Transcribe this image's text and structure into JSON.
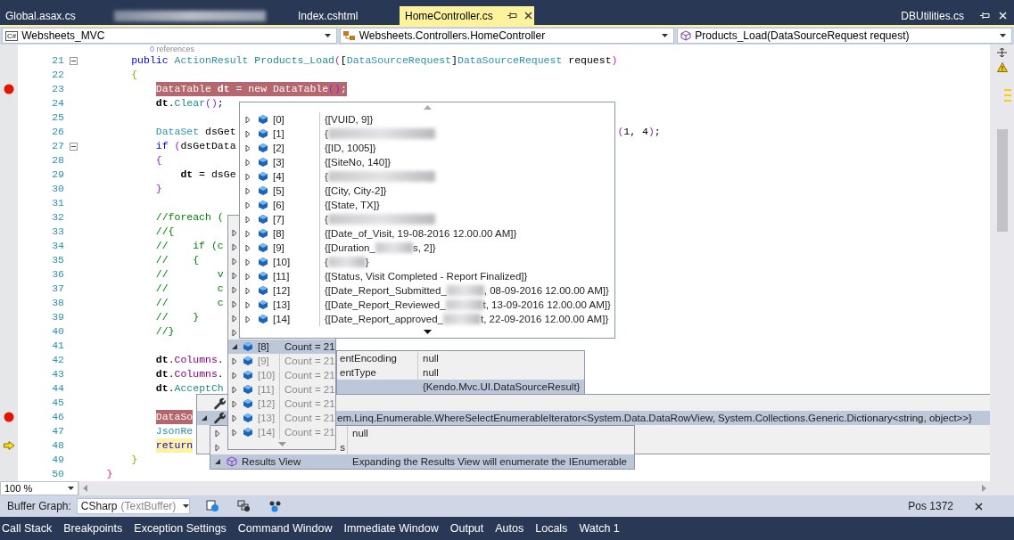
{
  "document_tabs": [
    {
      "label": "Global.asax.cs",
      "selected": false
    },
    {
      "label": "Index.cshtml",
      "selected": false
    },
    {
      "label": "HomeController.cs",
      "selected": true
    }
  ],
  "preview_tab": {
    "label": "DBUtilities.cs"
  },
  "navigation_bar": {
    "project_badge": "C#",
    "project": "Websheets_MVC",
    "type": "Websheets.Controllers.HomeController",
    "member": "Products_Load(DataSourceRequest request)"
  },
  "editor": {
    "codelens": "0 references",
    "zoom": "100 %",
    "lines": [
      {
        "number": "21",
        "breakpoint": false,
        "current_statement": false,
        "fold": true,
        "kind": "class",
        "tokens": [
          {
            "kind": "kw",
            "text": "public "
          },
          {
            "kind": "type",
            "text": "ActionResult "
          },
          {
            "kind": "method",
            "text": "Products_Load"
          },
          {
            "kind": "brace3",
            "text": "("
          },
          {
            "kind": "plain",
            "text": "["
          },
          {
            "kind": "type",
            "text": "DataSourceRequest"
          },
          {
            "kind": "plain",
            "text": "]"
          },
          {
            "kind": "type",
            "text": "DataSourceRequest"
          },
          {
            "kind": "plain",
            "text": " request"
          },
          {
            "kind": "brace3",
            "text": ")"
          }
        ]
      },
      {
        "number": "22",
        "breakpoint": false,
        "current_statement": false,
        "fold": false,
        "kind": "class",
        "tokens": [
          {
            "kind": "brace1",
            "text": "{"
          }
        ]
      },
      {
        "number": "23",
        "breakpoint": true,
        "current_statement": false,
        "fold": false,
        "kind": "method",
        "tokens": [
          {
            "kind": "type",
            "text": "DataTable "
          },
          {
            "kind": "local",
            "text": "dt"
          },
          {
            "kind": "plain",
            "text": " = "
          },
          {
            "kind": "kw",
            "text": "new "
          },
          {
            "kind": "type",
            "text": "DataTable"
          },
          {
            "kind": "brace2",
            "text": "()"
          },
          {
            "kind": "plain",
            "text": ";"
          }
        ]
      },
      {
        "number": "24",
        "breakpoint": false,
        "current_statement": false,
        "fold": false,
        "kind": "method",
        "tokens": [
          {
            "kind": "local",
            "text": "dt"
          },
          {
            "kind": "plain",
            "text": "."
          },
          {
            "kind": "method",
            "text": "Clear"
          },
          {
            "kind": "brace2",
            "text": "()"
          },
          {
            "kind": "plain",
            "text": ";"
          }
        ]
      },
      {
        "number": "25",
        "breakpoint": false,
        "current_statement": false,
        "fold": false
      },
      {
        "number": "26",
        "breakpoint": false,
        "current_statement": false,
        "fold": false,
        "kind": "method",
        "tokens": [
          {
            "kind": "type",
            "text": "DataSet "
          },
          {
            "kind": "plain",
            "text": "dsGet"
          }
        ],
        "tail": [
          {
            "kind": "brace2",
            "text": "("
          },
          {
            "kind": "plain",
            "text": "1, 4"
          },
          {
            "kind": "brace2",
            "text": ")"
          },
          {
            "kind": "plain",
            "text": ";"
          }
        ]
      },
      {
        "number": "27",
        "breakpoint": false,
        "current_statement": false,
        "fold": true,
        "kind": "method",
        "tokens": [
          {
            "kind": "kw",
            "text": "if "
          },
          {
            "kind": "brace2",
            "text": "("
          },
          {
            "kind": "plain",
            "text": "dsGetData"
          }
        ]
      },
      {
        "number": "28",
        "breakpoint": false,
        "current_statement": false,
        "fold": false,
        "kind": "method",
        "tokens": [
          {
            "kind": "brace2",
            "text": "{"
          }
        ]
      },
      {
        "number": "29",
        "breakpoint": false,
        "current_statement": false,
        "fold": false,
        "kind": "nested",
        "tokens": [
          {
            "kind": "local",
            "text": "dt"
          },
          {
            "kind": "plain",
            "text": " = dsGe"
          }
        ]
      },
      {
        "number": "30",
        "breakpoint": false,
        "current_statement": false,
        "fold": false,
        "kind": "method",
        "tokens": [
          {
            "kind": "brace2",
            "text": "}"
          }
        ]
      },
      {
        "number": "31",
        "breakpoint": false,
        "current_statement": false,
        "fold": false
      },
      {
        "number": "32",
        "breakpoint": false,
        "current_statement": false,
        "fold": false,
        "kind": "method",
        "tokens": [
          {
            "kind": "comment",
            "text": "//foreach ("
          }
        ]
      },
      {
        "number": "33",
        "breakpoint": false,
        "current_statement": false,
        "fold": false,
        "kind": "method",
        "tokens": [
          {
            "kind": "comment",
            "text": "//{"
          }
        ]
      },
      {
        "number": "34",
        "breakpoint": false,
        "current_statement": false,
        "fold": false,
        "kind": "method",
        "tokens": [
          {
            "kind": "comment",
            "text": "//    if (c"
          }
        ]
      },
      {
        "number": "35",
        "breakpoint": false,
        "current_statement": false,
        "fold": false,
        "kind": "method",
        "tokens": [
          {
            "kind": "comment",
            "text": "//    {"
          }
        ]
      },
      {
        "number": "36",
        "breakpoint": false,
        "current_statement": false,
        "fold": false,
        "kind": "method",
        "tokens": [
          {
            "kind": "comment",
            "text": "//        v"
          }
        ]
      },
      {
        "number": "37",
        "breakpoint": false,
        "current_statement": false,
        "fold": false,
        "kind": "method",
        "tokens": [
          {
            "kind": "comment",
            "text": "//        c"
          }
        ]
      },
      {
        "number": "38",
        "breakpoint": false,
        "current_statement": false,
        "fold": false,
        "kind": "method",
        "tokens": [
          {
            "kind": "comment",
            "text": "//        c"
          }
        ]
      },
      {
        "number": "39",
        "breakpoint": false,
        "current_statement": false,
        "fold": false,
        "kind": "method",
        "tokens": [
          {
            "kind": "comment",
            "text": "//    }"
          }
        ]
      },
      {
        "number": "40",
        "breakpoint": false,
        "current_statement": false,
        "fold": false,
        "kind": "method",
        "tokens": [
          {
            "kind": "comment",
            "text": "//}"
          }
        ]
      },
      {
        "number": "41",
        "breakpoint": false,
        "current_statement": false,
        "fold": false
      },
      {
        "number": "42",
        "breakpoint": false,
        "current_statement": false,
        "fold": false,
        "kind": "method",
        "tokens": [
          {
            "kind": "local",
            "text": "dt"
          },
          {
            "kind": "plain",
            "text": "."
          },
          {
            "kind": "property",
            "text": "Columns"
          },
          {
            "kind": "plain",
            "text": "."
          }
        ]
      },
      {
        "number": "43",
        "breakpoint": false,
        "current_statement": false,
        "fold": false,
        "kind": "method",
        "tokens": [
          {
            "kind": "local",
            "text": "dt"
          },
          {
            "kind": "plain",
            "text": "."
          },
          {
            "kind": "property",
            "text": "Columns"
          },
          {
            "kind": "plain",
            "text": "."
          }
        ]
      },
      {
        "number": "44",
        "breakpoint": false,
        "current_statement": false,
        "fold": false,
        "kind": "method",
        "tokens": [
          {
            "kind": "local",
            "text": "dt"
          },
          {
            "kind": "plain",
            "text": "."
          },
          {
            "kind": "method",
            "text": "AcceptCh"
          }
        ]
      },
      {
        "number": "45",
        "breakpoint": false,
        "current_statement": false,
        "fold": false
      },
      {
        "number": "46",
        "breakpoint": true,
        "current_statement": false,
        "fold": false,
        "kind": "method",
        "tokens": [
          {
            "kind": "type",
            "text": "DataSo"
          }
        ]
      },
      {
        "number": "47",
        "breakpoint": false,
        "current_statement": false,
        "fold": false,
        "kind": "method",
        "tokens": [
          {
            "kind": "type",
            "text": "JsonRe"
          }
        ]
      },
      {
        "number": "48",
        "breakpoint": false,
        "current_statement": true,
        "fold": false,
        "kind": "method",
        "tokens": [
          {
            "kind": "kw",
            "text": "return"
          }
        ]
      },
      {
        "number": "49",
        "breakpoint": false,
        "current_statement": false,
        "fold": false,
        "kind": "class",
        "tokens": [
          {
            "kind": "brace1",
            "text": "}"
          }
        ]
      },
      {
        "number": "50",
        "breakpoint": false,
        "current_statement": false,
        "fold": false,
        "kind": "namespace",
        "tokens": [
          {
            "kind": "brace3",
            "text": "}"
          }
        ]
      }
    ]
  },
  "data_tip": {
    "rows": [
      {
        "index": "[0]",
        "value": "{[VUID, 9]}",
        "redacted": false,
        "expanded": false
      },
      {
        "index": "[1]",
        "value": "{",
        "redacted": true,
        "expanded": false
      },
      {
        "index": "[2]",
        "value": "{[ID, 1005]}",
        "redacted": false,
        "expanded": false
      },
      {
        "index": "[3]",
        "value": "{[SiteNo, 140]}",
        "redacted": false,
        "expanded": false
      },
      {
        "index": "[4]",
        "value": "{",
        "redacted": true,
        "expanded": false
      },
      {
        "index": "[5]",
        "value": "{[City, City-2]}",
        "redacted": false,
        "expanded": false
      },
      {
        "index": "[6]",
        "value": "{[State, TX]}",
        "redacted": false,
        "expanded": false
      },
      {
        "index": "[7]",
        "value": "{",
        "redacted": true,
        "expanded": false
      },
      {
        "index": "[8]",
        "value": "{[Date_of_Visit, 19-08-2016 12.00.00 AM]}",
        "redacted": false,
        "expanded": false
      },
      {
        "index": "[9]",
        "value": "{[Duration_",
        "redacted": true,
        "value_tail": "s, 2]}",
        "expanded": false
      },
      {
        "index": "[10]",
        "value": "{",
        "redacted": true,
        "value_tail": "}",
        "expanded": false
      },
      {
        "index": "[11]",
        "value": "{[Status, Visit Completed - Report Finalized]}",
        "redacted": false,
        "expanded": false
      },
      {
        "index": "[12]",
        "value": "{[Date_Report_Submitted_",
        "redacted": true,
        "value_tail": ", 08-09-2016 12.00.00 AM]}",
        "expanded": false
      },
      {
        "index": "[13]",
        "value": "{[Date_Report_Reviewed_",
        "redacted": true,
        "value_tail": "t, 13-09-2016 12.00.00 AM]}",
        "expanded": false
      },
      {
        "index": "[14]",
        "value": "{[Date_Report_approved_",
        "redacted": true,
        "value_tail": "t, 22-09-2016 12.00.00 AM]}",
        "expanded": false
      }
    ]
  },
  "rows_tip": {
    "rows": [
      {
        "kind": "covered",
        "expanded": false
      },
      {
        "kind": "covered",
        "expanded": false
      },
      {
        "kind": "covered",
        "expanded": false
      },
      {
        "kind": "covered",
        "expanded": false
      },
      {
        "kind": "covered",
        "expanded": false
      },
      {
        "kind": "covered",
        "expanded": false
      },
      {
        "kind": "covered",
        "expanded": false
      },
      {
        "kind": "covered",
        "expanded": false
      },
      {
        "kind": "entry",
        "index": "[8]",
        "value": "Count = 21",
        "selected": true,
        "expanded": true,
        "dimmed": false
      },
      {
        "kind": "entry",
        "index": "[9]",
        "value": "Count = 21",
        "selected": false,
        "expanded": false,
        "dimmed": true
      },
      {
        "kind": "entry",
        "index": "[10]",
        "value": "Count = 21",
        "selected": false,
        "expanded": false,
        "dimmed": true
      },
      {
        "kind": "entry",
        "index": "[11]",
        "value": "Count = 21",
        "selected": false,
        "expanded": false,
        "dimmed": true
      },
      {
        "kind": "entry",
        "index": "[12]",
        "value": "Count = 21",
        "selected": false,
        "expanded": false,
        "dimmed": true
      },
      {
        "kind": "entry",
        "index": "[13]",
        "value": "Count = 21",
        "selected": false,
        "expanded": false,
        "dimmed": true
      },
      {
        "kind": "entry",
        "index": "[14]",
        "value": "Count = 21",
        "selected": false,
        "expanded": false,
        "dimmed": true
      }
    ]
  },
  "properties_tip": {
    "rows": [
      {
        "name": "entEncoding",
        "value": "null",
        "selected": false
      },
      {
        "name": "entType",
        "value": "null",
        "selected": false
      },
      {
        "value": "{Kendo.Mvc.UI.DataSourceResult}",
        "selected": true
      }
    ]
  },
  "iterator_tip": {
    "rows": [
      {
        "selected": false
      },
      {
        "value": "em.Linq.Enumerable.WhereSelectEnumerableIterator<System.Data.DataRowView, System.Collections.Generic.Dictionary<string, object>>}",
        "selected": true,
        "expanded": true
      }
    ]
  },
  "results_tip": {
    "rows": [
      {
        "value": "null",
        "selected": false,
        "expanded": false,
        "kind": "plain"
      },
      {
        "name": "s",
        "selected": false,
        "expanded": false,
        "kind": "plain"
      },
      {
        "name": "Results View",
        "value": "Expanding the Results View will enumerate the IEnumerable",
        "selected": true,
        "expanded": true,
        "kind": "results"
      }
    ]
  },
  "buffer_graph": {
    "label": "Buffer Graph:",
    "value": "CSharp",
    "hint": "(TextBuffer)",
    "position": "Pos 1372"
  },
  "tool_windows": [
    {
      "label": "Call Stack"
    },
    {
      "label": "Breakpoints"
    },
    {
      "label": "Exception Settings"
    },
    {
      "label": "Command Window"
    },
    {
      "label": "Immediate Window"
    },
    {
      "label": "Output"
    },
    {
      "label": "Autos"
    },
    {
      "label": "Locals"
    },
    {
      "label": "Watch 1"
    }
  ]
}
